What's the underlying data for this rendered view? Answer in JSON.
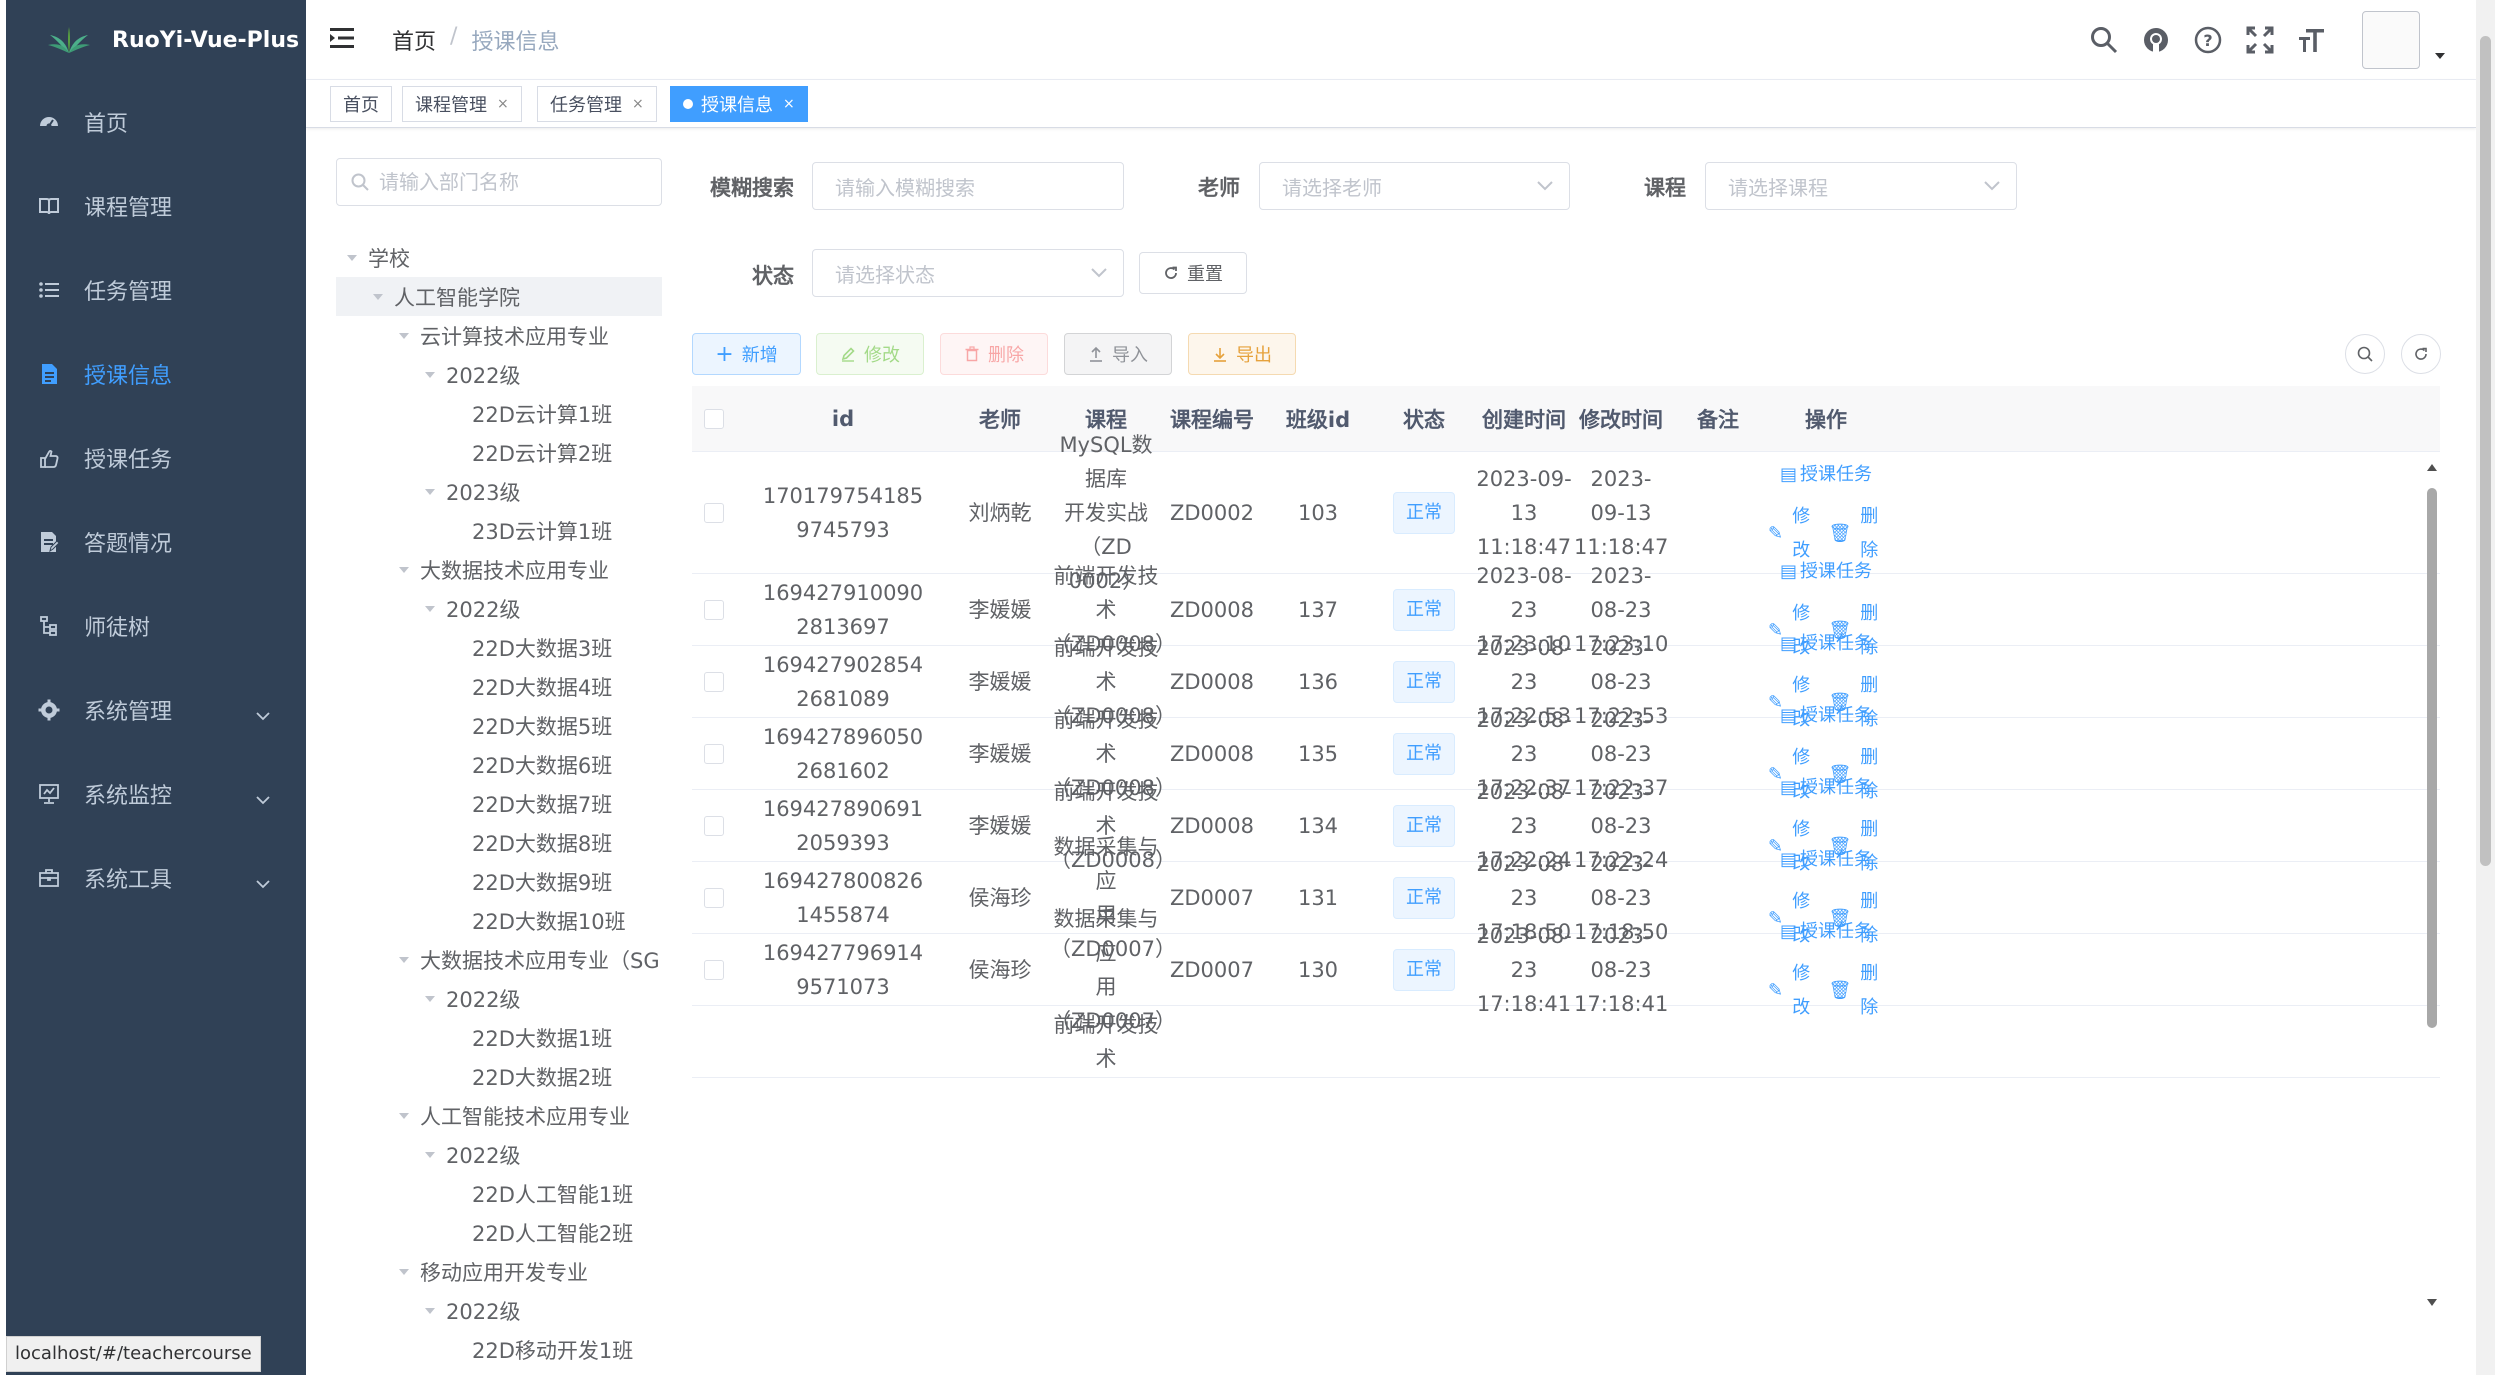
{
  "app": {
    "title": "RuoYi-Vue-Plus"
  },
  "sidebar": {
    "items": [
      {
        "label": "首页",
        "icon": "dashboard-icon"
      },
      {
        "label": "课程管理",
        "icon": "book-icon"
      },
      {
        "label": "任务管理",
        "icon": "list-icon"
      },
      {
        "label": "授课信息",
        "icon": "document-icon",
        "active": true
      },
      {
        "label": "授课任务",
        "icon": "hand-icon"
      },
      {
        "label": "答题情况",
        "icon": "edit-doc-icon"
      },
      {
        "label": "师徒树",
        "icon": "tree-icon"
      },
      {
        "label": "系统管理",
        "icon": "gear-icon",
        "expandable": true
      },
      {
        "label": "系统监控",
        "icon": "monitor-icon",
        "expandable": true
      },
      {
        "label": "系统工具",
        "icon": "toolbox-icon",
        "expandable": true
      }
    ]
  },
  "navbar": {
    "breadcrumb": {
      "home": "首页",
      "separator": "/",
      "current": "授课信息"
    },
    "icons": [
      "search-icon",
      "github-icon",
      "question-icon",
      "fullscreen-icon",
      "font-size-icon"
    ]
  },
  "tags": [
    {
      "label": "首页",
      "closable": false
    },
    {
      "label": "课程管理",
      "closable": true
    },
    {
      "label": "任务管理",
      "closable": true
    },
    {
      "label": "授课信息",
      "closable": true,
      "active": true
    }
  ],
  "tree": {
    "search_placeholder": "请输入部门名称",
    "nodes": [
      {
        "label": "学校",
        "level": 0,
        "expanded": true
      },
      {
        "label": "人工智能学院",
        "level": 1,
        "expanded": true,
        "selected": true
      },
      {
        "label": "云计算技术应用专业",
        "level": 2,
        "expanded": true
      },
      {
        "label": "2022级",
        "level": 3,
        "expanded": true
      },
      {
        "label": "22D云计算1班",
        "level": 4
      },
      {
        "label": "22D云计算2班",
        "level": 4
      },
      {
        "label": "2023级",
        "level": 3,
        "expanded": true
      },
      {
        "label": "23D云计算1班",
        "level": 4
      },
      {
        "label": "大数据技术应用专业",
        "level": 2,
        "expanded": true
      },
      {
        "label": "2022级",
        "level": 3,
        "expanded": true
      },
      {
        "label": "22D大数据3班",
        "level": 4
      },
      {
        "label": "22D大数据4班",
        "level": 4
      },
      {
        "label": "22D大数据5班",
        "level": 4
      },
      {
        "label": "22D大数据6班",
        "level": 4
      },
      {
        "label": "22D大数据7班",
        "level": 4
      },
      {
        "label": "22D大数据8班",
        "level": 4
      },
      {
        "label": "22D大数据9班",
        "level": 4
      },
      {
        "label": "22D大数据10班",
        "level": 4
      },
      {
        "label": "大数据技术应用专业（SG",
        "level": 2,
        "expanded": true
      },
      {
        "label": "2022级",
        "level": 3,
        "expanded": true
      },
      {
        "label": "22D大数据1班",
        "level": 4
      },
      {
        "label": "22D大数据2班",
        "level": 4
      },
      {
        "label": "人工智能技术应用专业",
        "level": 2,
        "expanded": true
      },
      {
        "label": "2022级",
        "level": 3,
        "expanded": true
      },
      {
        "label": "22D人工智能1班",
        "level": 4
      },
      {
        "label": "22D人工智能2班",
        "level": 4
      },
      {
        "label": "移动应用开发专业",
        "level": 2,
        "expanded": true
      },
      {
        "label": "2022级",
        "level": 3,
        "expanded": true
      },
      {
        "label": "22D移动开发1班",
        "level": 4
      }
    ]
  },
  "search": {
    "fuzzy_label": "模糊搜索",
    "fuzzy_placeholder": "请输入模糊搜索",
    "teacher_label": "老师",
    "teacher_placeholder": "请选择老师",
    "course_label": "课程",
    "course_placeholder": "请选择课程",
    "status_label": "状态",
    "status_placeholder": "请选择状态",
    "reset_label": "重置"
  },
  "toolbar": {
    "add_label": "新增",
    "edit_label": "修改",
    "delete_label": "删除",
    "import_label": "导入",
    "export_label": "导出"
  },
  "table": {
    "columns": [
      "id",
      "老师",
      "课程",
      "课程编号",
      "班级id",
      "状态",
      "创建时间",
      "修改时间",
      "备注",
      "操作"
    ],
    "op_assign": "授课任务",
    "op_edit": "修改",
    "op_delete": "删除",
    "rows": [
      {
        "id": [
          "170179754185",
          "9745793"
        ],
        "teacher": "刘炳乾",
        "course": [
          "MySQL数据库",
          "开发实战（ZD",
          "0002）"
        ],
        "code": "ZD0002",
        "class_id": "103",
        "status": "正常",
        "created": [
          "2023-09-13",
          "11:18:47"
        ],
        "updated": [
          "2023-09-13",
          "11:18:47"
        ],
        "remark": ""
      },
      {
        "id": [
          "169427910090",
          "2813697"
        ],
        "teacher": "李媛媛",
        "course": [
          "前端开发技术",
          "（ZD0008）"
        ],
        "code": "ZD0008",
        "class_id": "137",
        "status": "正常",
        "created": [
          "2023-08-23",
          "17:23:10"
        ],
        "updated": [
          "2023-08-23",
          "17:23:10"
        ],
        "remark": ""
      },
      {
        "id": [
          "169427902854",
          "2681089"
        ],
        "teacher": "李媛媛",
        "course": [
          "前端开发技术",
          "（ZD0008）"
        ],
        "code": "ZD0008",
        "class_id": "136",
        "status": "正常",
        "created": [
          "2023-08-23",
          "17:22:53"
        ],
        "updated": [
          "2023-08-23",
          "17:22:53"
        ],
        "remark": ""
      },
      {
        "id": [
          "169427896050",
          "2681602"
        ],
        "teacher": "李媛媛",
        "course": [
          "前端开发技术",
          "（ZD0008）"
        ],
        "code": "ZD0008",
        "class_id": "135",
        "status": "正常",
        "created": [
          "2023-08-23",
          "17:22:37"
        ],
        "updated": [
          "2023-08-23",
          "17:22:37"
        ],
        "remark": ""
      },
      {
        "id": [
          "169427890691",
          "2059393"
        ],
        "teacher": "李媛媛",
        "course": [
          "前端开发技术",
          "（ZD0008）"
        ],
        "code": "ZD0008",
        "class_id": "134",
        "status": "正常",
        "created": [
          "2023-08-23",
          "17:22:24"
        ],
        "updated": [
          "2023-08-23",
          "17:22:24"
        ],
        "remark": ""
      },
      {
        "id": [
          "169427800826",
          "1455874"
        ],
        "teacher": "侯海珍",
        "course": [
          "数据采集与应",
          "用（ZD0007）"
        ],
        "code": "ZD0007",
        "class_id": "131",
        "status": "正常",
        "created": [
          "2023-08-23",
          "17:18:50"
        ],
        "updated": [
          "2023-08-23",
          "17:18:50"
        ],
        "remark": ""
      },
      {
        "id": [
          "169427796914",
          "9571073"
        ],
        "teacher": "侯海珍",
        "course": [
          "数据采集与应",
          "用（ZD0007）"
        ],
        "code": "ZD0007",
        "class_id": "130",
        "status": "正常",
        "created": [
          "2023-08-23",
          "17:18:41"
        ],
        "updated": [
          "2023-08-23",
          "17:18:41"
        ],
        "remark": ""
      },
      {
        "id": [
          "",
          ""
        ],
        "teacher": "",
        "course": [
          "前端开发技术",
          ""
        ],
        "code": "",
        "class_id": "",
        "status": "",
        "created": [
          "",
          ""
        ],
        "updated": [
          "",
          ""
        ],
        "remark": ""
      }
    ]
  },
  "statusbar": {
    "url": "localhost/#/teachercourse"
  },
  "colors": {
    "sidebar_bg": "#304156",
    "accent": "#409eff",
    "menu_text": "#bfcbd9"
  }
}
